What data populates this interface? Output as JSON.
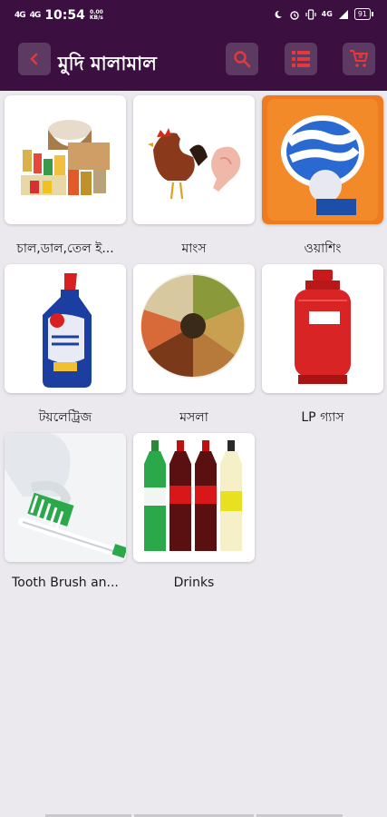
{
  "status_bar": {
    "signal1": "4G",
    "signal2": "4G",
    "time": "10:54",
    "speed_value": "0.00",
    "speed_unit": "KB/s",
    "network": "4G",
    "battery": "91"
  },
  "app_bar": {
    "title": "মুদি মালামাল",
    "back_icon": "chevron-left-icon",
    "search_icon": "search-icon",
    "list_icon": "list-icon",
    "cart_icon": "cart-icon"
  },
  "categories": [
    {
      "label": "চাল,ডাল,তেল ই...",
      "image": "groceries-image"
    },
    {
      "label": "মাংস",
      "image": "meat-image"
    },
    {
      "label": "ওয়াশিং",
      "image": "washing-powder-image"
    },
    {
      "label": "টয়লেট্রিজ",
      "image": "toilet-cleaner-image"
    },
    {
      "label": "মসলা",
      "image": "spices-image"
    },
    {
      "label": "LP গ্যাস",
      "image": "gas-cylinder-image"
    },
    {
      "label": "Tooth Brush an...",
      "image": "toothbrush-image"
    },
    {
      "label": "Drinks",
      "image": "drinks-image"
    }
  ],
  "colors": {
    "header": "#3b1040",
    "button": "#5d3a61",
    "accent": "#e23a3a",
    "background": "#ebe9ee"
  }
}
